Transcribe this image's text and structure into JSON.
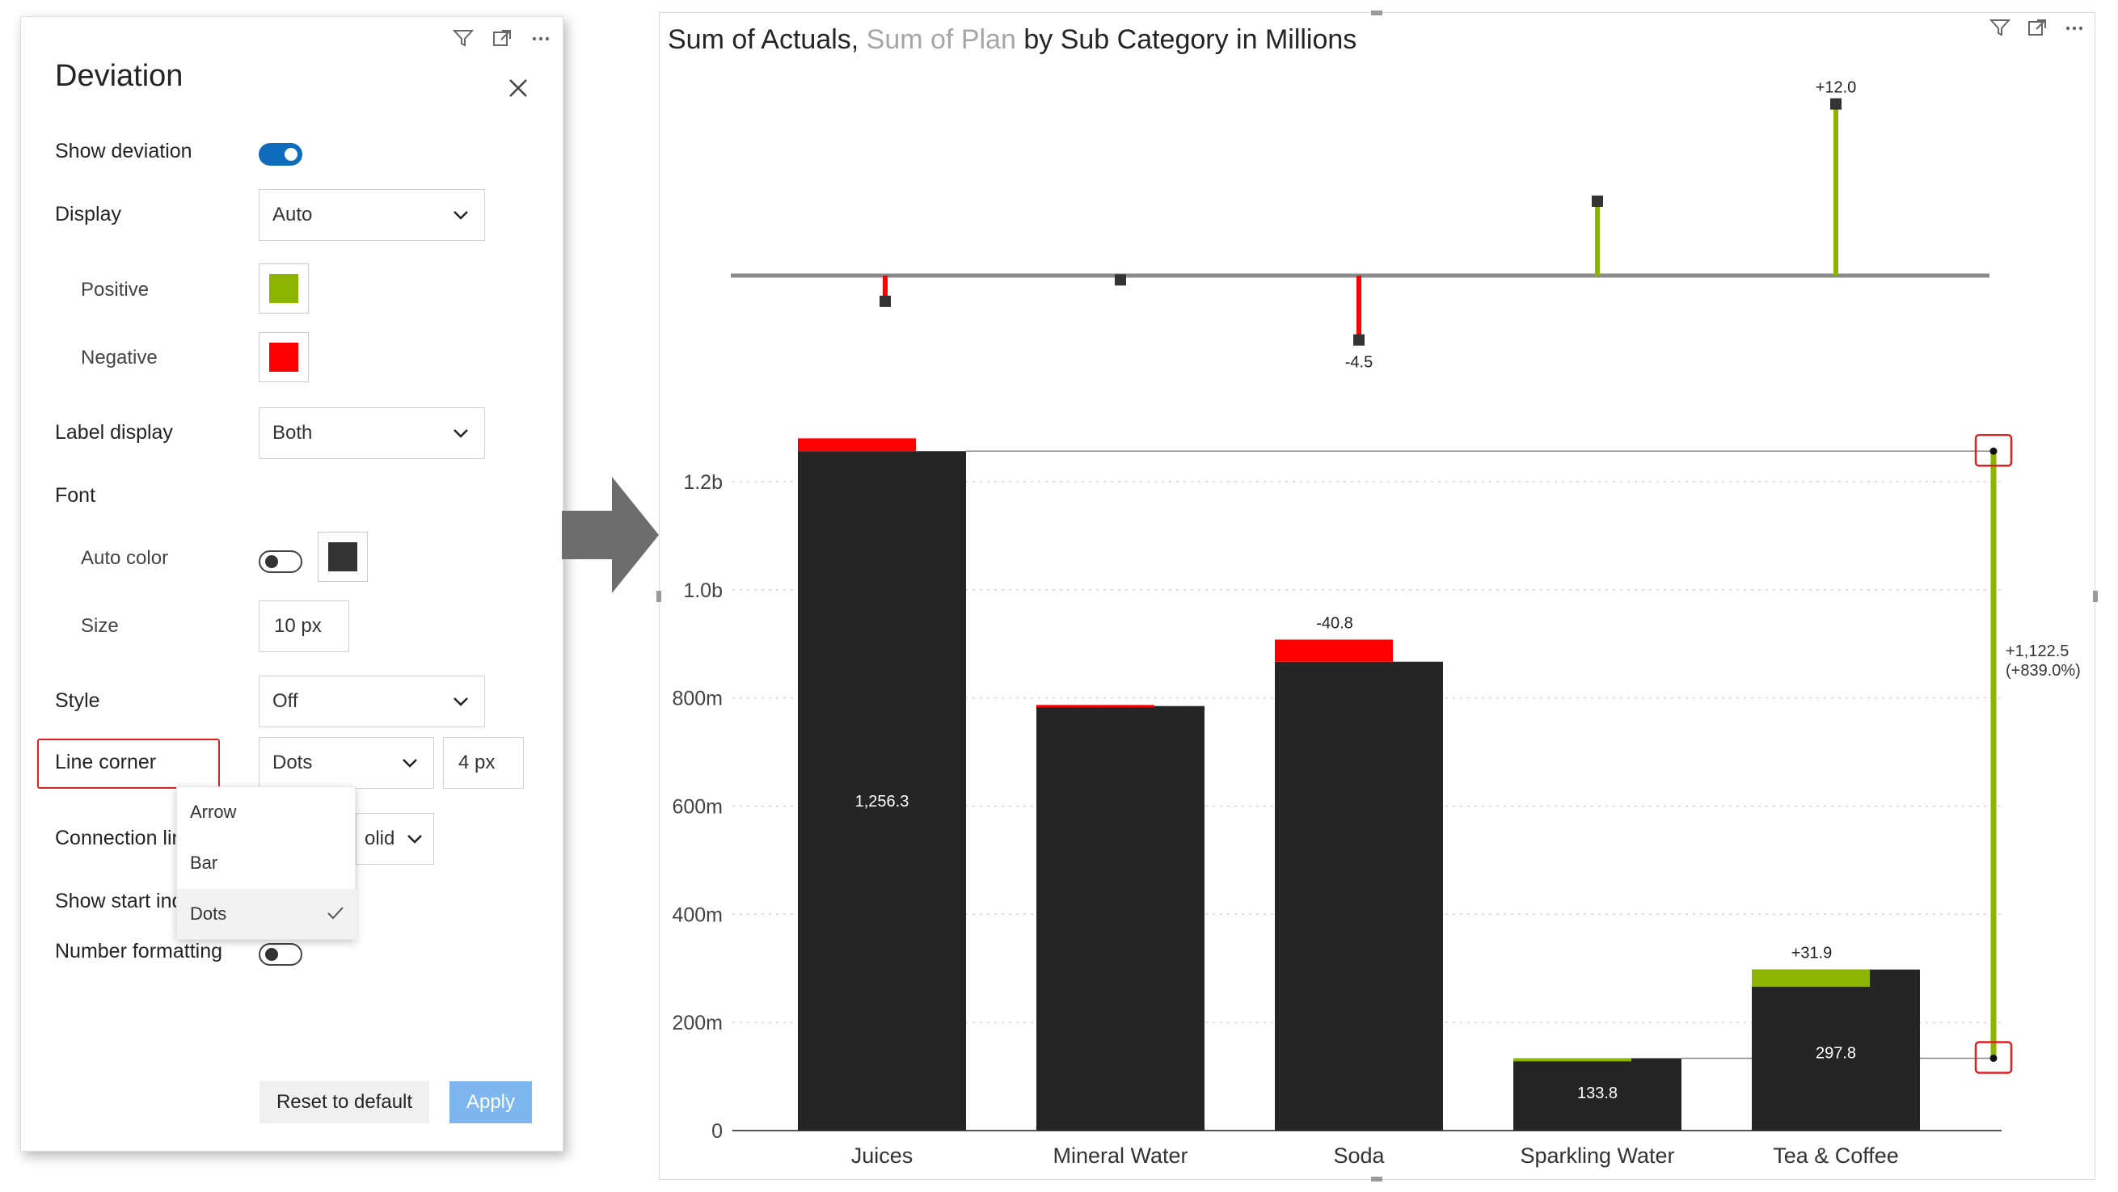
{
  "panel": {
    "title": "Deviation",
    "header_icons": [
      "filter-icon",
      "focus-mode-icon",
      "more-options-icon"
    ],
    "show_deviation": {
      "label": "Show deviation",
      "on": true
    },
    "display": {
      "label": "Display",
      "value": "Auto"
    },
    "positive": {
      "label": "Positive",
      "color": "#8cb400"
    },
    "negative": {
      "label": "Negative",
      "color": "#ff0000"
    },
    "label_display": {
      "label": "Label display",
      "value": "Both"
    },
    "font": {
      "label": "Font"
    },
    "auto_color": {
      "label": "Auto color",
      "on": false,
      "color": "#333333"
    },
    "size": {
      "label": "Size",
      "value": "10",
      "unit": "px"
    },
    "style": {
      "label": "Style",
      "value": "Off"
    },
    "line_corner": {
      "label": "Line corner",
      "value": "Dots",
      "size_value": "4",
      "size_unit": "px"
    },
    "line_corner_options": [
      {
        "label": "Arrow",
        "selected": false
      },
      {
        "label": "Bar",
        "selected": false
      },
      {
        "label": "Dots",
        "selected": true
      }
    ],
    "connection_line": {
      "label": "Connection line",
      "value_partial": "olid"
    },
    "show_start_indicator": {
      "label": "Show start indicator"
    },
    "number_formatting": {
      "label": "Number formatting",
      "on": false
    },
    "reset_label": "Reset to default",
    "apply_label": "Apply"
  },
  "visual": {
    "title_part1": "Sum of Actuals, ",
    "title_part2": "Sum of Plan",
    "title_part3": " by Sub Category in Millions",
    "header_icons": [
      "filter-icon",
      "focus-mode-icon",
      "more-options-icon"
    ]
  },
  "colors": {
    "positive": "#8cb400",
    "negative": "#ff0000",
    "bar": "#252525",
    "accent": "#0f6cbd",
    "highlight": "#e02020"
  },
  "chart_data": {
    "type": "bar",
    "title": "Sum of Actuals, Sum of Plan by Sub Category in Millions",
    "categories": [
      "Juices",
      "Mineral Water",
      "Soda",
      "Sparkling Water",
      "Tea & Coffee"
    ],
    "series": [
      {
        "name": "Sum of Actuals",
        "values": [
          1256.3,
          785,
          867,
          133.8,
          297.8
        ]
      },
      {
        "name": "Sum of Plan",
        "values": [
          1280,
          787,
          907.8,
          128,
          265.9
        ]
      }
    ],
    "bar_labels": [
      "1,256.3",
      "",
      "",
      "133.8",
      "297.8"
    ],
    "deviation_labels": [
      "",
      "",
      "-40.8",
      "",
      "+31.9"
    ],
    "top_deviation": {
      "values": [
        -1.8,
        -0.3,
        -4.5,
        5.2,
        12.0
      ],
      "labels": [
        "",
        "",
        "-4.5",
        "",
        "+12.0"
      ]
    },
    "total_difference": {
      "label": "+1,122.5",
      "percent": "(+839.0%)",
      "from": 133.8,
      "to": 1256.3
    },
    "yticks": [
      "0",
      "200m",
      "400m",
      "600m",
      "800m",
      "1.0b",
      "1.2b"
    ],
    "ytick_values": [
      0,
      200,
      400,
      600,
      800,
      1000,
      1200
    ],
    "ylim": [
      0,
      1300
    ],
    "grid": true
  }
}
